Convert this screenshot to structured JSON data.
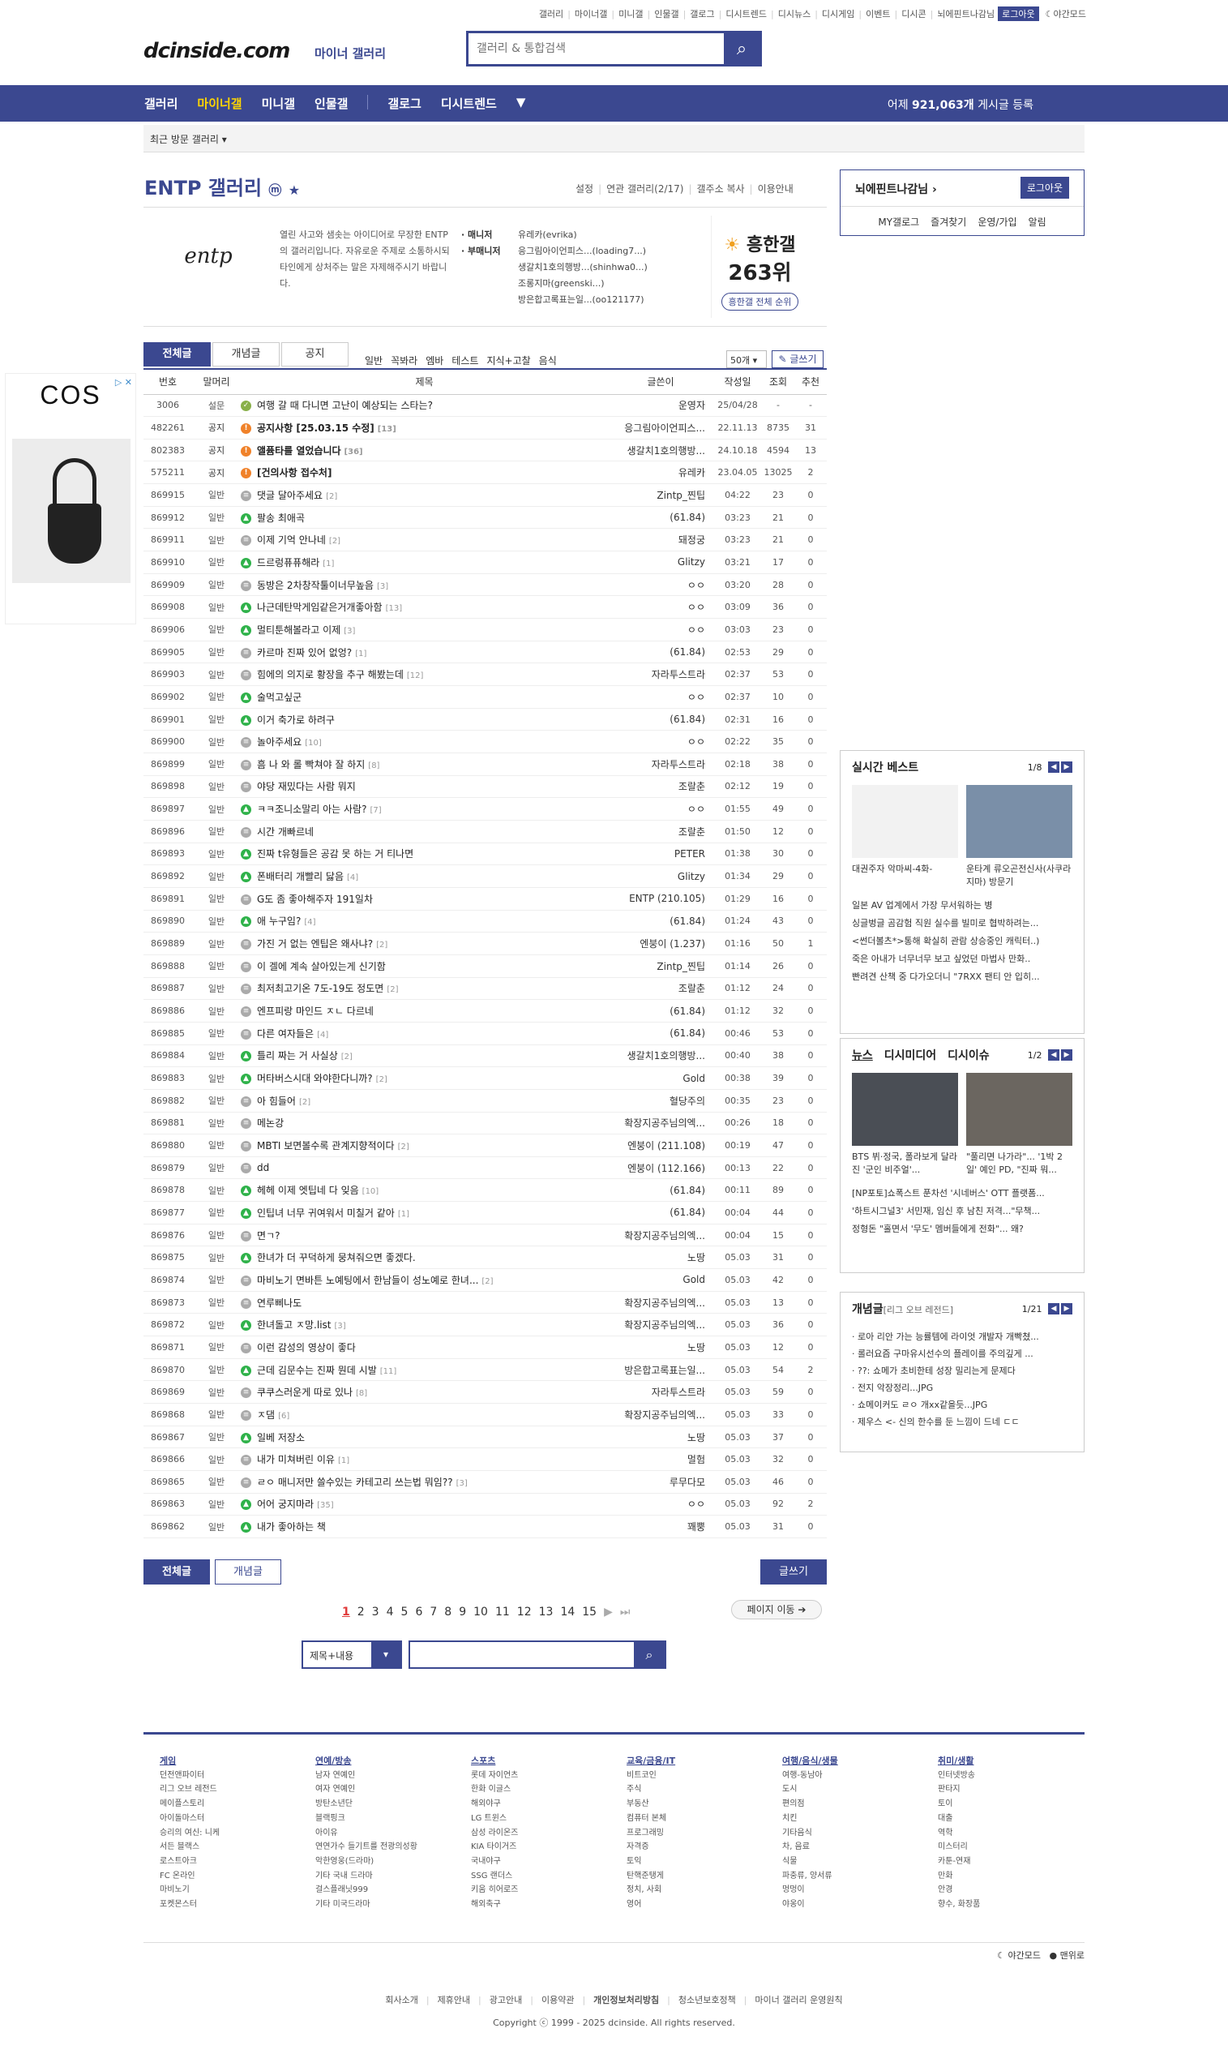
{
  "topbar": {
    "links": [
      "갤러리",
      "마이너갤",
      "미니갤",
      "인물갤",
      "갤로그",
      "디시트렌드",
      "디시뉴스",
      "디시게임",
      "이벤트",
      "디시콘"
    ],
    "user": "뇌에핀트나감님",
    "logout": "로그아웃",
    "darkmode": "야간모드"
  },
  "header": {
    "logo": "dcinside.com",
    "logo_sub": "마이너 갤러리",
    "search_placeholder": "갤러리 & 통합검색"
  },
  "gnb": {
    "items": [
      "갤러리",
      "마이너갤",
      "미니갤",
      "인물갤",
      "갤로그",
      "디시트렌드"
    ],
    "active_index": 1,
    "stats_prefix": "어제",
    "stats_count": "921,063개",
    "stats_suffix": "게시글 등록"
  },
  "recent": {
    "label": "최근 방문 갤러리"
  },
  "gallery": {
    "title": "ENTP 갤러리",
    "links": [
      "설정",
      "연관 갤러리(2/17)",
      "갤주소 복사",
      "이용안내"
    ],
    "desc": "열린 사고와 샘솟는 아이디어로 무장한 ENTP의 갤러리입니다. 자유로운 주제로 소통하시되 타인에게 상처주는 말은 자제해주시기 바랍니다.",
    "logo_text": "entp",
    "manager_label": "· 매니저",
    "submanager_label": "· 부매니저",
    "managers": [
      "유레카(evrika)",
      "응그림아이언피스...(loading7...)",
      "생갈치1호의행방...(shinhwa0...)",
      "조롱지마(greenski...)",
      "방은합고록표는일...(oo121177)"
    ],
    "hot_label": "흥한갤",
    "hot_rank": "263위",
    "hot_btn": "흥한갤 전체 순위"
  },
  "loginbox": {
    "nick": "뇌에핀트나감님",
    "logout": "로그아웃",
    "links": [
      "MY갤로그",
      "즐겨찾기",
      "운영/가입",
      "알림"
    ]
  },
  "ad": {
    "brand": "COS"
  },
  "tabs": [
    "전체글",
    "개념글",
    "공지"
  ],
  "subtabs": [
    "일반",
    "꼭봐라",
    "엠바",
    "테스트",
    "지식+고찰",
    "음식"
  ],
  "list_count": "50개",
  "write_btn": "글쓰기",
  "columns": [
    "번호",
    "말머리",
    "제목",
    "글쓴이",
    "작성일",
    "조회",
    "추천"
  ],
  "posts": [
    {
      "no": "3006",
      "sub": "설문",
      "title": "여행 갈 때 다니면 고난이 예상되는 스타는?",
      "rc": "",
      "writer": "운영자",
      "date": "25/04/28",
      "views": "-",
      "rec": "-",
      "type": "survey"
    },
    {
      "no": "482261",
      "sub": "공지",
      "title": "공지사항 [25.03.15 수정]",
      "rc": "[13]",
      "writer": "응그림아이언피스...",
      "date": "22.11.13",
      "views": "8735",
      "rec": "31",
      "type": "notice"
    },
    {
      "no": "802383",
      "sub": "공지",
      "title": "앨퓸타를 열었습니다",
      "rc": "[36]",
      "writer": "생갈치1호의행방...",
      "date": "24.10.18",
      "views": "4594",
      "rec": "13",
      "type": "notice"
    },
    {
      "no": "575211",
      "sub": "공지",
      "title": "[건의사항 접수처]",
      "rc": "",
      "writer": "유레카",
      "date": "23.04.05",
      "views": "13025",
      "rec": "2",
      "type": "notice"
    },
    {
      "no": "869915",
      "sub": "일반",
      "title": "댓글 달아주세요",
      "rc": "[2]",
      "writer": "Zintp_찐팁",
      "date": "04:22",
      "views": "23",
      "rec": "0",
      "type": "text"
    },
    {
      "no": "869912",
      "sub": "일반",
      "title": "팔송 최애곡",
      "rc": "",
      "writer": "(61.84)",
      "date": "03:23",
      "views": "21",
      "rec": "0",
      "type": "img"
    },
    {
      "no": "869911",
      "sub": "일반",
      "title": "이제 기억 안나네",
      "rc": "[2]",
      "writer": "돼정궁",
      "date": "03:23",
      "views": "21",
      "rec": "0",
      "type": "text"
    },
    {
      "no": "869910",
      "sub": "일반",
      "title": "드르렁퓨퓨해라",
      "rc": "[1]",
      "writer": "Glitzy",
      "date": "03:21",
      "views": "17",
      "rec": "0",
      "type": "img"
    },
    {
      "no": "869909",
      "sub": "일반",
      "title": "동방은 2차창작툴이너무높음",
      "rc": "[3]",
      "writer": "ㅇㅇ",
      "date": "03:20",
      "views": "28",
      "rec": "0",
      "type": "text"
    },
    {
      "no": "869908",
      "sub": "일반",
      "title": "나근데탄막게임같은거개좋아함",
      "rc": "[13]",
      "writer": "ㅇㅇ",
      "date": "03:09",
      "views": "36",
      "rec": "0",
      "type": "img"
    },
    {
      "no": "869906",
      "sub": "일반",
      "title": "멀티툰해볼라고 이제",
      "rc": "[3]",
      "writer": "ㅇㅇ",
      "date": "03:03",
      "views": "23",
      "rec": "0",
      "type": "img"
    },
    {
      "no": "869905",
      "sub": "일반",
      "title": "카르마 진짜 있어 없엉?",
      "rc": "[1]",
      "writer": "(61.84)",
      "date": "02:53",
      "views": "29",
      "rec": "0",
      "type": "text"
    },
    {
      "no": "869903",
      "sub": "일반",
      "title": "힘에의 의지로 황장을 추구 해봤는데",
      "rc": "[12]",
      "writer": "자라투스트라",
      "date": "02:37",
      "views": "53",
      "rec": "0",
      "type": "text"
    },
    {
      "no": "869902",
      "sub": "일반",
      "title": "술먹고싶군",
      "rc": "",
      "writer": "ㅇㅇ",
      "date": "02:37",
      "views": "10",
      "rec": "0",
      "type": "img"
    },
    {
      "no": "869901",
      "sub": "일반",
      "title": "이거 축가로 하려구",
      "rc": "",
      "writer": "(61.84)",
      "date": "02:31",
      "views": "16",
      "rec": "0",
      "type": "img"
    },
    {
      "no": "869900",
      "sub": "일반",
      "title": "놀아주세요",
      "rc": "[10]",
      "writer": "ㅇㅇ",
      "date": "02:22",
      "views": "35",
      "rec": "0",
      "type": "text"
    },
    {
      "no": "869899",
      "sub": "일반",
      "title": "흠 나 와 롤 빡쳐야 잘 하지",
      "rc": "[8]",
      "writer": "자라투스트라",
      "date": "02:18",
      "views": "38",
      "rec": "0",
      "type": "text"
    },
    {
      "no": "869898",
      "sub": "일반",
      "title": "야당 재밌다는 사람 뭐지",
      "rc": "",
      "writer": "조랄춘",
      "date": "02:12",
      "views": "19",
      "rec": "0",
      "type": "text"
    },
    {
      "no": "869897",
      "sub": "일반",
      "title": "ㅋㅋ조니소말리 아는 사람?",
      "rc": "[7]",
      "writer": "ㅇㅇ",
      "date": "01:55",
      "views": "49",
      "rec": "0",
      "type": "img"
    },
    {
      "no": "869896",
      "sub": "일반",
      "title": "시간 개빠르네",
      "rc": "",
      "writer": "조랄춘",
      "date": "01:50",
      "views": "12",
      "rec": "0",
      "type": "text"
    },
    {
      "no": "869893",
      "sub": "일반",
      "title": "진짜 t유형들은 공감 못 하는 거 티나면",
      "rc": "",
      "writer": "PETER",
      "date": "01:38",
      "views": "30",
      "rec": "0",
      "type": "img"
    },
    {
      "no": "869892",
      "sub": "일반",
      "title": "폰배터리 개빨리 닳음",
      "rc": "[4]",
      "writer": "Glitzy",
      "date": "01:34",
      "views": "29",
      "rec": "0",
      "type": "img"
    },
    {
      "no": "869891",
      "sub": "일반",
      "title": "G도 좀 좋아해주자 191일차",
      "rc": "",
      "writer": "ENTP (210.105)",
      "date": "01:29",
      "views": "16",
      "rec": "0",
      "type": "text"
    },
    {
      "no": "869890",
      "sub": "일반",
      "title": "애 누구임?",
      "rc": "[4]",
      "writer": "(61.84)",
      "date": "01:24",
      "views": "43",
      "rec": "0",
      "type": "img"
    },
    {
      "no": "869889",
      "sub": "일반",
      "title": "가진 거 없는 엔팁은 왜사냐?",
      "rc": "[2]",
      "writer": "엔붕이 (1.237)",
      "date": "01:16",
      "views": "50",
      "rec": "1",
      "type": "text"
    },
    {
      "no": "869888",
      "sub": "일반",
      "title": "이 겔에 계속 살아있는게 신기함",
      "rc": "",
      "writer": "Zintp_찐팁",
      "date": "01:14",
      "views": "26",
      "rec": "0",
      "type": "text"
    },
    {
      "no": "869887",
      "sub": "일반",
      "title": "최저최고기온 7도-19도 정도면",
      "rc": "[2]",
      "writer": "조랄춘",
      "date": "01:12",
      "views": "24",
      "rec": "0",
      "type": "text"
    },
    {
      "no": "869886",
      "sub": "일반",
      "title": "엔프피랑 마인드 ㅈㄴ 다르네",
      "rc": "",
      "writer": "(61.84)",
      "date": "01:12",
      "views": "32",
      "rec": "0",
      "type": "text"
    },
    {
      "no": "869885",
      "sub": "일반",
      "title": "다른 여자들은",
      "rc": "[4]",
      "writer": "(61.84)",
      "date": "00:46",
      "views": "53",
      "rec": "0",
      "type": "text"
    },
    {
      "no": "869884",
      "sub": "일반",
      "title": "틀리 짜는 거 사실상",
      "rc": "[2]",
      "writer": "생갈치1호의행방...",
      "date": "00:40",
      "views": "38",
      "rec": "0",
      "type": "img"
    },
    {
      "no": "869883",
      "sub": "일반",
      "title": "머타버스시대 와야한다니까?",
      "rc": "[2]",
      "writer": "Gold",
      "date": "00:38",
      "views": "39",
      "rec": "0",
      "type": "img"
    },
    {
      "no": "869882",
      "sub": "일반",
      "title": "아 힘들어",
      "rc": "[2]",
      "writer": "혈당주의",
      "date": "00:35",
      "views": "23",
      "rec": "0",
      "type": "text"
    },
    {
      "no": "869881",
      "sub": "일반",
      "title": "메논강",
      "rc": "",
      "writer": "확장지공주님의엑...",
      "date": "00:26",
      "views": "18",
      "rec": "0",
      "type": "text"
    },
    {
      "no": "869880",
      "sub": "일반",
      "title": "MBTI 보면볼수록 관계지향적이다",
      "rc": "[2]",
      "writer": "엔붕이 (211.108)",
      "date": "00:19",
      "views": "47",
      "rec": "0",
      "type": "text"
    },
    {
      "no": "869879",
      "sub": "일반",
      "title": "dd",
      "rc": "",
      "writer": "엔붕이 (112.166)",
      "date": "00:13",
      "views": "22",
      "rec": "0",
      "type": "text"
    },
    {
      "no": "869878",
      "sub": "일반",
      "title": "헤헤 이제 엣팁네 다 잊음",
      "rc": "[10]",
      "writer": "(61.84)",
      "date": "00:11",
      "views": "89",
      "rec": "0",
      "type": "img"
    },
    {
      "no": "869877",
      "sub": "일반",
      "title": "인팁녀 너무 귀여워서 미칠거 같아",
      "rc": "[1]",
      "writer": "(61.84)",
      "date": "00:04",
      "views": "44",
      "rec": "0",
      "type": "img"
    },
    {
      "no": "869876",
      "sub": "일반",
      "title": "면ㄱ?",
      "rc": "",
      "writer": "확장지공주님의엑...",
      "date": "00:04",
      "views": "15",
      "rec": "0",
      "type": "text"
    },
    {
      "no": "869875",
      "sub": "일반",
      "title": "한녀가 더 꾸덕하게 뭉쳐줘으면 좋겠다.",
      "rc": "",
      "writer": "노땅",
      "date": "05.03",
      "views": "31",
      "rec": "0",
      "type": "img"
    },
    {
      "no": "869874",
      "sub": "일반",
      "title": "마비노기 면바튼 노예팅에서 한남들이 성노예로 한녀...",
      "rc": "[2]",
      "writer": "Gold",
      "date": "05.03",
      "views": "42",
      "rec": "0",
      "type": "text"
    },
    {
      "no": "869873",
      "sub": "일반",
      "title": "연루삐나도",
      "rc": "",
      "writer": "확장지공주님의엑...",
      "date": "05.03",
      "views": "13",
      "rec": "0",
      "type": "text"
    },
    {
      "no": "869872",
      "sub": "일반",
      "title": "한녀돌고 ㅈ망.list",
      "rc": "[3]",
      "writer": "확장지공주님의엑...",
      "date": "05.03",
      "views": "36",
      "rec": "0",
      "type": "img"
    },
    {
      "no": "869871",
      "sub": "일반",
      "title": "이런 감성의 영상이 좋다",
      "rc": "",
      "writer": "노땅",
      "date": "05.03",
      "views": "12",
      "rec": "0",
      "type": "text"
    },
    {
      "no": "869870",
      "sub": "일반",
      "title": "근데 김문수는 진짜 뭔데 시발",
      "rc": "[11]",
      "writer": "방은합고록표는일...",
      "date": "05.03",
      "views": "54",
      "rec": "2",
      "type": "img"
    },
    {
      "no": "869869",
      "sub": "일반",
      "title": "쿠쿠스러운게 따로 있나",
      "rc": "[8]",
      "writer": "자라투스트라",
      "date": "05.03",
      "views": "59",
      "rec": "0",
      "type": "text"
    },
    {
      "no": "869868",
      "sub": "일반",
      "title": "ㅈ댐",
      "rc": "[6]",
      "writer": "확장지공주님의엑...",
      "date": "05.03",
      "views": "33",
      "rec": "0",
      "type": "text"
    },
    {
      "no": "869867",
      "sub": "일반",
      "title": "일베 저장소",
      "rc": "",
      "writer": "노땅",
      "date": "05.03",
      "views": "37",
      "rec": "0",
      "type": "img"
    },
    {
      "no": "869866",
      "sub": "일반",
      "title": "내가 미쳐버린 이유",
      "rc": "[1]",
      "writer": "멀험",
      "date": "05.03",
      "views": "32",
      "rec": "0",
      "type": "text"
    },
    {
      "no": "869865",
      "sub": "일반",
      "title": "ㄹㅇ 매니저만 쓸수있는 카테고리 쓰는법 뭐임??",
      "rc": "[3]",
      "writer": "루무다모",
      "date": "05.03",
      "views": "46",
      "rec": "0",
      "type": "text"
    },
    {
      "no": "869863",
      "sub": "일반",
      "title": "어어 궁지마라",
      "rc": "[35]",
      "writer": "ㅇㅇ",
      "date": "05.03",
      "views": "92",
      "rec": "2",
      "type": "img"
    },
    {
      "no": "869862",
      "sub": "일반",
      "title": "내가 좋아하는 책",
      "rc": "",
      "writer": "꽤뿡",
      "date": "05.03",
      "views": "31",
      "rec": "0",
      "type": "img"
    }
  ],
  "bottom_buttons": {
    "all": "전체글",
    "concept": "개념글",
    "write": "글쓰기"
  },
  "paging": {
    "pages": [
      "1",
      "2",
      "3",
      "4",
      "5",
      "6",
      "7",
      "8",
      "9",
      "10",
      "11",
      "12",
      "13",
      "14",
      "15"
    ],
    "move": "페이지 이동"
  },
  "bottom_search": {
    "select": "제목+내용"
  },
  "realtime": {
    "title": "실시간 베스트",
    "page": "1/8",
    "thumbs": [
      "대권주자 악마씨-4화-",
      "운타계 류오곤전신사(사쿠라지마) 방문기"
    ],
    "lines": [
      "일본 AV 업계에서 가장 무서워하는 병",
      "싱글벙글 곰감험 직원 실수를 빌미로 협박하려는...",
      "<썬더볼츠*>통해 확실히 관람 상승중인 캐릭터..)",
      "죽은 아내가 너무너무 보고 싶었던 마법사 만화..",
      "빤려견 산책 중 다가오더니 \"7RXX 팬티 안 입히..."
    ]
  },
  "news": {
    "tabs": [
      "뉴스",
      "디시미디어",
      "디시이슈"
    ],
    "page": "1/2",
    "thumbs": [
      "BTS 뷔·정국, 폴라보게 달라진 '군인 비주얼'...",
      "\"풀리면 나가라\"... '1박 2일' 예인 PD, \"진짜 뭐..."
    ],
    "lines": [
      "[NP포토]쇼폭스트 푼차선 '시네버스' OTT 플랫폼...",
      "'하트시그널3' 서민재, 임신 후 남친 저격...\"무책...",
      "정형돈 \"홀면서 '무도' 멤버들에게 전화\"... 왜?"
    ]
  },
  "concept": {
    "title": "개념글",
    "sub": "[리그 오브 레전드]",
    "page": "1/21",
    "lines": [
      "· 로아 리안 가는 능률템에 라이엇 개발자 개빡쳤...",
      "· 롤러요즘 구마유시선수의 플레이를 주의깊게 ...",
      "· ??: 쇼메가 초비한테 성장 밀리는게 문제다",
      "· 전지 악장정리...JPG",
      "· 쇼메이커도 ㄹㅇ 개xx같을듯...JPG",
      "· 제우스 <- 신의 한수를 둔 느낌이 드네 ㄷㄷ"
    ]
  },
  "footer": {
    "cols": [
      {
        "h": "게임",
        "items": [
          "던전앤파이터",
          "리그 오브 레전드",
          "메이플스토리",
          "아이돌마스터",
          "승리의 여신: 니케",
          "서든 블랙스",
          "로스트아크",
          "FC 온라인",
          "마비노기",
          "포켓몬스터"
        ]
      },
      {
        "h": "연예/방송",
        "items": [
          "남자 연예인",
          "여자 연예인",
          "방탄소년단",
          "블랙핑크",
          "아이유",
          "연연가수 들기트를 전광의성황",
          "악한영웅(드라마)",
          "기타 국내 드라마",
          "걸스플래닛999",
          "기타 미국드라마"
        ]
      },
      {
        "h": "스포츠",
        "items": [
          "롯데 자이언츠",
          "한화 이글스",
          "해외야구",
          "LG 트윈스",
          "삼성 라이온즈",
          "KIA 타이거즈",
          "국내야구",
          "SSG 랜더스",
          "키움 히어로즈",
          "해외축구"
        ]
      },
      {
        "h": "교육/금융/IT",
        "items": [
          "비트코인",
          "주식",
          "부동산",
          "컴퓨터 본체",
          "프로그래밍",
          "자격증",
          "토익",
          "탄핵준탱게",
          "정치, 사회",
          "영어"
        ]
      },
      {
        "h": "여행/음식/생물",
        "items": [
          "여행-동남아",
          "도시",
          "편의점",
          "치킨",
          "기타음식",
          "차, 음료",
          "식물",
          "파충류, 양서류",
          "멍멍이",
          "야옹이"
        ]
      },
      {
        "h": "취미/생활",
        "items": [
          "인터넷방송",
          "판타지",
          "토이",
          "대출",
          "역학",
          "미스터리",
          "카툰-연재",
          "만화",
          "안경",
          "향수, 화장품"
        ]
      }
    ],
    "dark": "야간모드",
    "pc": "맨위로",
    "links": [
      "회사소개",
      "제휴안내",
      "광고안내",
      "이용약관",
      "개인정보처리방침",
      "청소년보호정책",
      "마이너 갤러리 운영원칙"
    ],
    "copyright": "Copyright ⓒ 1999 - 2025 dcinside. All rights reserved."
  }
}
